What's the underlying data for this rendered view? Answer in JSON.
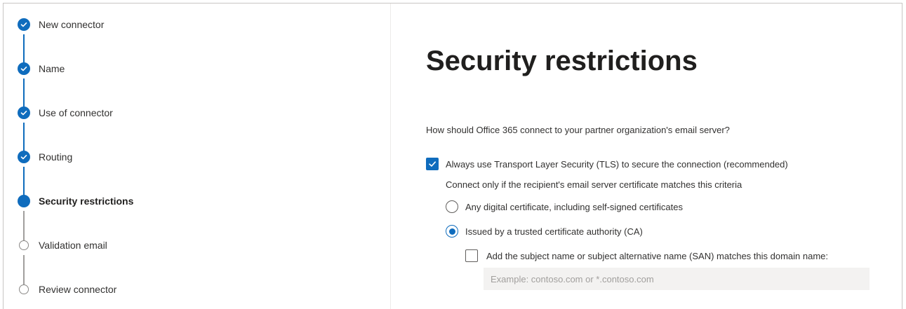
{
  "wizard": {
    "steps": [
      {
        "label": "New connector",
        "state": "done"
      },
      {
        "label": "Name",
        "state": "done"
      },
      {
        "label": "Use of connector",
        "state": "done"
      },
      {
        "label": "Routing",
        "state": "done"
      },
      {
        "label": "Security restrictions",
        "state": "current"
      },
      {
        "label": "Validation email",
        "state": "todo"
      },
      {
        "label": "Review connector",
        "state": "todo"
      }
    ]
  },
  "main": {
    "title": "Security restrictions",
    "question": "How should Office 365 connect to your partner organization's email server?",
    "tls_checkbox": {
      "label": "Always use Transport Layer Security (TLS) to secure the connection (recommended)",
      "checked": true
    },
    "criteria_text": "Connect only if the recipient's email server certificate matches this criteria",
    "cert_options": [
      {
        "label": "Any digital certificate, including self-signed certificates",
        "selected": false
      },
      {
        "label": "Issued by a trusted certificate authority (CA)",
        "selected": true
      }
    ],
    "san_checkbox": {
      "label": "Add the subject name or subject alternative name (SAN) matches this domain name:",
      "checked": false
    },
    "domain_input": {
      "value": "",
      "placeholder": "Example: contoso.com or *.contoso.com"
    }
  },
  "colors": {
    "accent": "#0f6cbd",
    "pending": "#8a8886",
    "input_bg": "#f3f2f1"
  },
  "icons": {
    "done_step": "checkmark-circle-icon",
    "current_step": "filled-circle-icon",
    "todo_step": "empty-circle-icon",
    "checkbox_checked": "checkmark-icon"
  }
}
